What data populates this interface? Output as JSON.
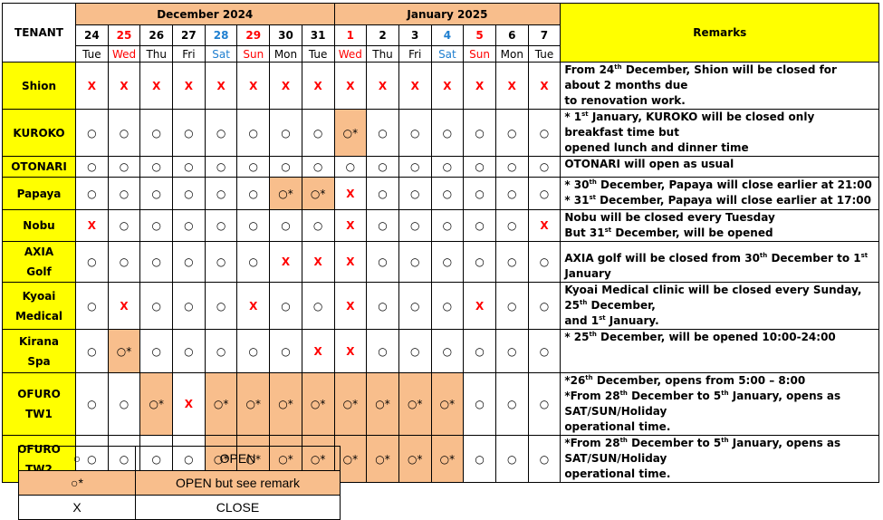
{
  "header": {
    "tenant_label": "TENANT",
    "remarks_label": "Remarks",
    "months": [
      {
        "label": "December 2024",
        "span": 8
      },
      {
        "label": "January 2025",
        "span": 7
      }
    ]
  },
  "dates": [
    {
      "d": "24",
      "w": "Tue",
      "c": ""
    },
    {
      "d": "25",
      "w": "Wed",
      "c": "red"
    },
    {
      "d": "26",
      "w": "Thu",
      "c": ""
    },
    {
      "d": "27",
      "w": "Fri",
      "c": ""
    },
    {
      "d": "28",
      "w": "Sat",
      "c": "blue"
    },
    {
      "d": "29",
      "w": "Sun",
      "c": "red"
    },
    {
      "d": "30",
      "w": "Mon",
      "c": ""
    },
    {
      "d": "31",
      "w": "Tue",
      "c": ""
    },
    {
      "d": "1",
      "w": "Wed",
      "c": "red"
    },
    {
      "d": "2",
      "w": "Thu",
      "c": ""
    },
    {
      "d": "3",
      "w": "Fri",
      "c": ""
    },
    {
      "d": "4",
      "w": "Sat",
      "c": "blue"
    },
    {
      "d": "5",
      "w": "Sun",
      "c": "red"
    },
    {
      "d": "6",
      "w": "Mon",
      "c": ""
    },
    {
      "d": "7",
      "w": "Tue",
      "c": ""
    }
  ],
  "symbols": {
    "o": "○",
    "s": "○*",
    "x": "X"
  },
  "colors": {
    "highlight": "#f8be8c",
    "tenant_bg": "#ffff00",
    "closed": "#ff0000",
    "saturday": "#1f7fd0"
  },
  "rows": [
    {
      "name": [
        "Shion"
      ],
      "h": 33,
      "cells": "xxxxxxxxxxxxxxx",
      "valign": "top",
      "remarks": [
        [
          [
            "From 24"
          ],
          [
            "th",
            1
          ],
          [
            " December, Shion will be closed for about 2 months due"
          ]
        ],
        [
          [
            "to renovation work."
          ]
        ]
      ]
    },
    {
      "name": [
        "KUROKO"
      ],
      "h": 34,
      "cells": "oooooooosoooooo",
      "valign": "top",
      "remarks": [
        [
          [
            "* 1"
          ],
          [
            "st",
            1
          ],
          [
            " January, KUROKO will be closed only breakfast time but"
          ]
        ],
        [
          [
            "opened lunch and dinner time"
          ]
        ]
      ]
    },
    {
      "name": [
        "OTONARI"
      ],
      "h": 21,
      "cells": "ooooooooooooooo",
      "valign": "top",
      "remarks": [
        [
          [
            "OTONARI will open as usual"
          ]
        ]
      ]
    },
    {
      "name": [
        "Papaya"
      ],
      "h": 36,
      "cells": "oooooossxoooooo",
      "valign": "top",
      "remarks": [
        [
          [
            "* 30"
          ],
          [
            "th",
            1
          ],
          [
            " December, Papaya will close earlier at 21:00"
          ]
        ],
        [
          [
            "* 31"
          ],
          [
            "st",
            1
          ],
          [
            " December, Papaya will close earlier at 17:00"
          ]
        ]
      ]
    },
    {
      "name": [
        "Nobu"
      ],
      "h": 34,
      "cells": "xoooooooxooooox",
      "valign": "top",
      "remarks": [
        [
          [
            "Nobu will be closed every Tuesday"
          ]
        ],
        [
          [
            "But 31"
          ],
          [
            "st",
            1
          ],
          [
            " December, will be opened"
          ]
        ]
      ]
    },
    {
      "name": [
        "AXIA",
        "Golf"
      ],
      "h": 44,
      "cells": "ooooooxxxoooooo",
      "valign": "bottom",
      "remarks": [
        [
          [
            "AXIA golf will be closed from 30"
          ],
          [
            "th",
            1
          ],
          [
            " December to 1"
          ],
          [
            "st",
            1
          ],
          [
            " January"
          ]
        ]
      ]
    },
    {
      "name": [
        "Kyoai",
        "Medical"
      ],
      "h": 46,
      "cells": "oxoooxooxoooxoo",
      "valign": "bottom",
      "remarks": [
        [
          [
            "Kyoai Medical clinic will be closed every Sunday, 25"
          ],
          [
            "th",
            1
          ],
          [
            " December,"
          ]
        ],
        [
          [
            "and 1"
          ],
          [
            "st",
            1
          ],
          [
            " January."
          ]
        ]
      ]
    },
    {
      "name": [
        "Kirana",
        "Spa"
      ],
      "h": 48,
      "cells": "osoooooxxoooooo",
      "valign": "top",
      "remarks": [
        [
          [
            "* 25"
          ],
          [
            "th",
            1
          ],
          [
            " December, will be opened 10:00-24:00"
          ]
        ]
      ]
    },
    {
      "name": [
        "OFURO",
        "TW1"
      ],
      "h": 50,
      "cells": "oosxssssssssooo",
      "valign": "top",
      "remarks": [
        [
          [
            "*26"
          ],
          [
            "th",
            1
          ],
          [
            " December, opens from 5:00 – 8:00"
          ]
        ],
        [
          [
            "*From 28"
          ],
          [
            "th",
            1
          ],
          [
            " December to 5"
          ],
          [
            "th",
            1
          ],
          [
            " January, opens as SAT/SUN/Holiday"
          ]
        ],
        [
          [
            "operational time."
          ]
        ]
      ]
    },
    {
      "name": [
        "OFURO",
        "TW2"
      ],
      "h": 46,
      "cells": "oooossssssssooo",
      "valign": "bottom",
      "remarks": [
        [
          [
            "*From 28"
          ],
          [
            "th",
            1
          ],
          [
            " December to 5"
          ],
          [
            "th",
            1
          ],
          [
            " January, opens as SAT/SUN/Holiday"
          ]
        ],
        [
          [
            "operational time."
          ]
        ]
      ]
    }
  ],
  "legend": [
    {
      "symbol": "○",
      "label": "OPEN",
      "hl": false
    },
    {
      "symbol": "○*",
      "label": "OPEN but see remark",
      "hl": true
    },
    {
      "symbol": "X",
      "label": "CLOSE",
      "hl": false
    }
  ]
}
